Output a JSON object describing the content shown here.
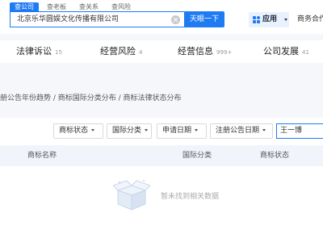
{
  "search": {
    "tabs": [
      "查公司",
      "查老板",
      "查关系",
      "查风险"
    ],
    "active_tab": 0,
    "value": "北京乐华圆娱文化传播有限公司",
    "button_label": "天眼一下"
  },
  "header": {
    "apps_label": "应用",
    "biz_link": "商务合作"
  },
  "nav": [
    {
      "label": "法律诉讼",
      "count": "15"
    },
    {
      "label": "经营风险",
      "count": "4"
    },
    {
      "label": "经营信息",
      "count": "999+"
    },
    {
      "label": "公司发展",
      "count": "41"
    }
  ],
  "breadcrumb": "册公告年份趋势 / 商标国际分类分布 / 商标法律状态分布",
  "filters": {
    "buttons": [
      "商标状态",
      "国际分类",
      "申请日期",
      "注册公告日期"
    ],
    "search_value": "王一博"
  },
  "table": {
    "columns": [
      "商标名称",
      "国际分类",
      "商标状态"
    ],
    "empty_text": "暂未找到相关数据"
  },
  "colors": {
    "accent": "#1f7bf2"
  }
}
